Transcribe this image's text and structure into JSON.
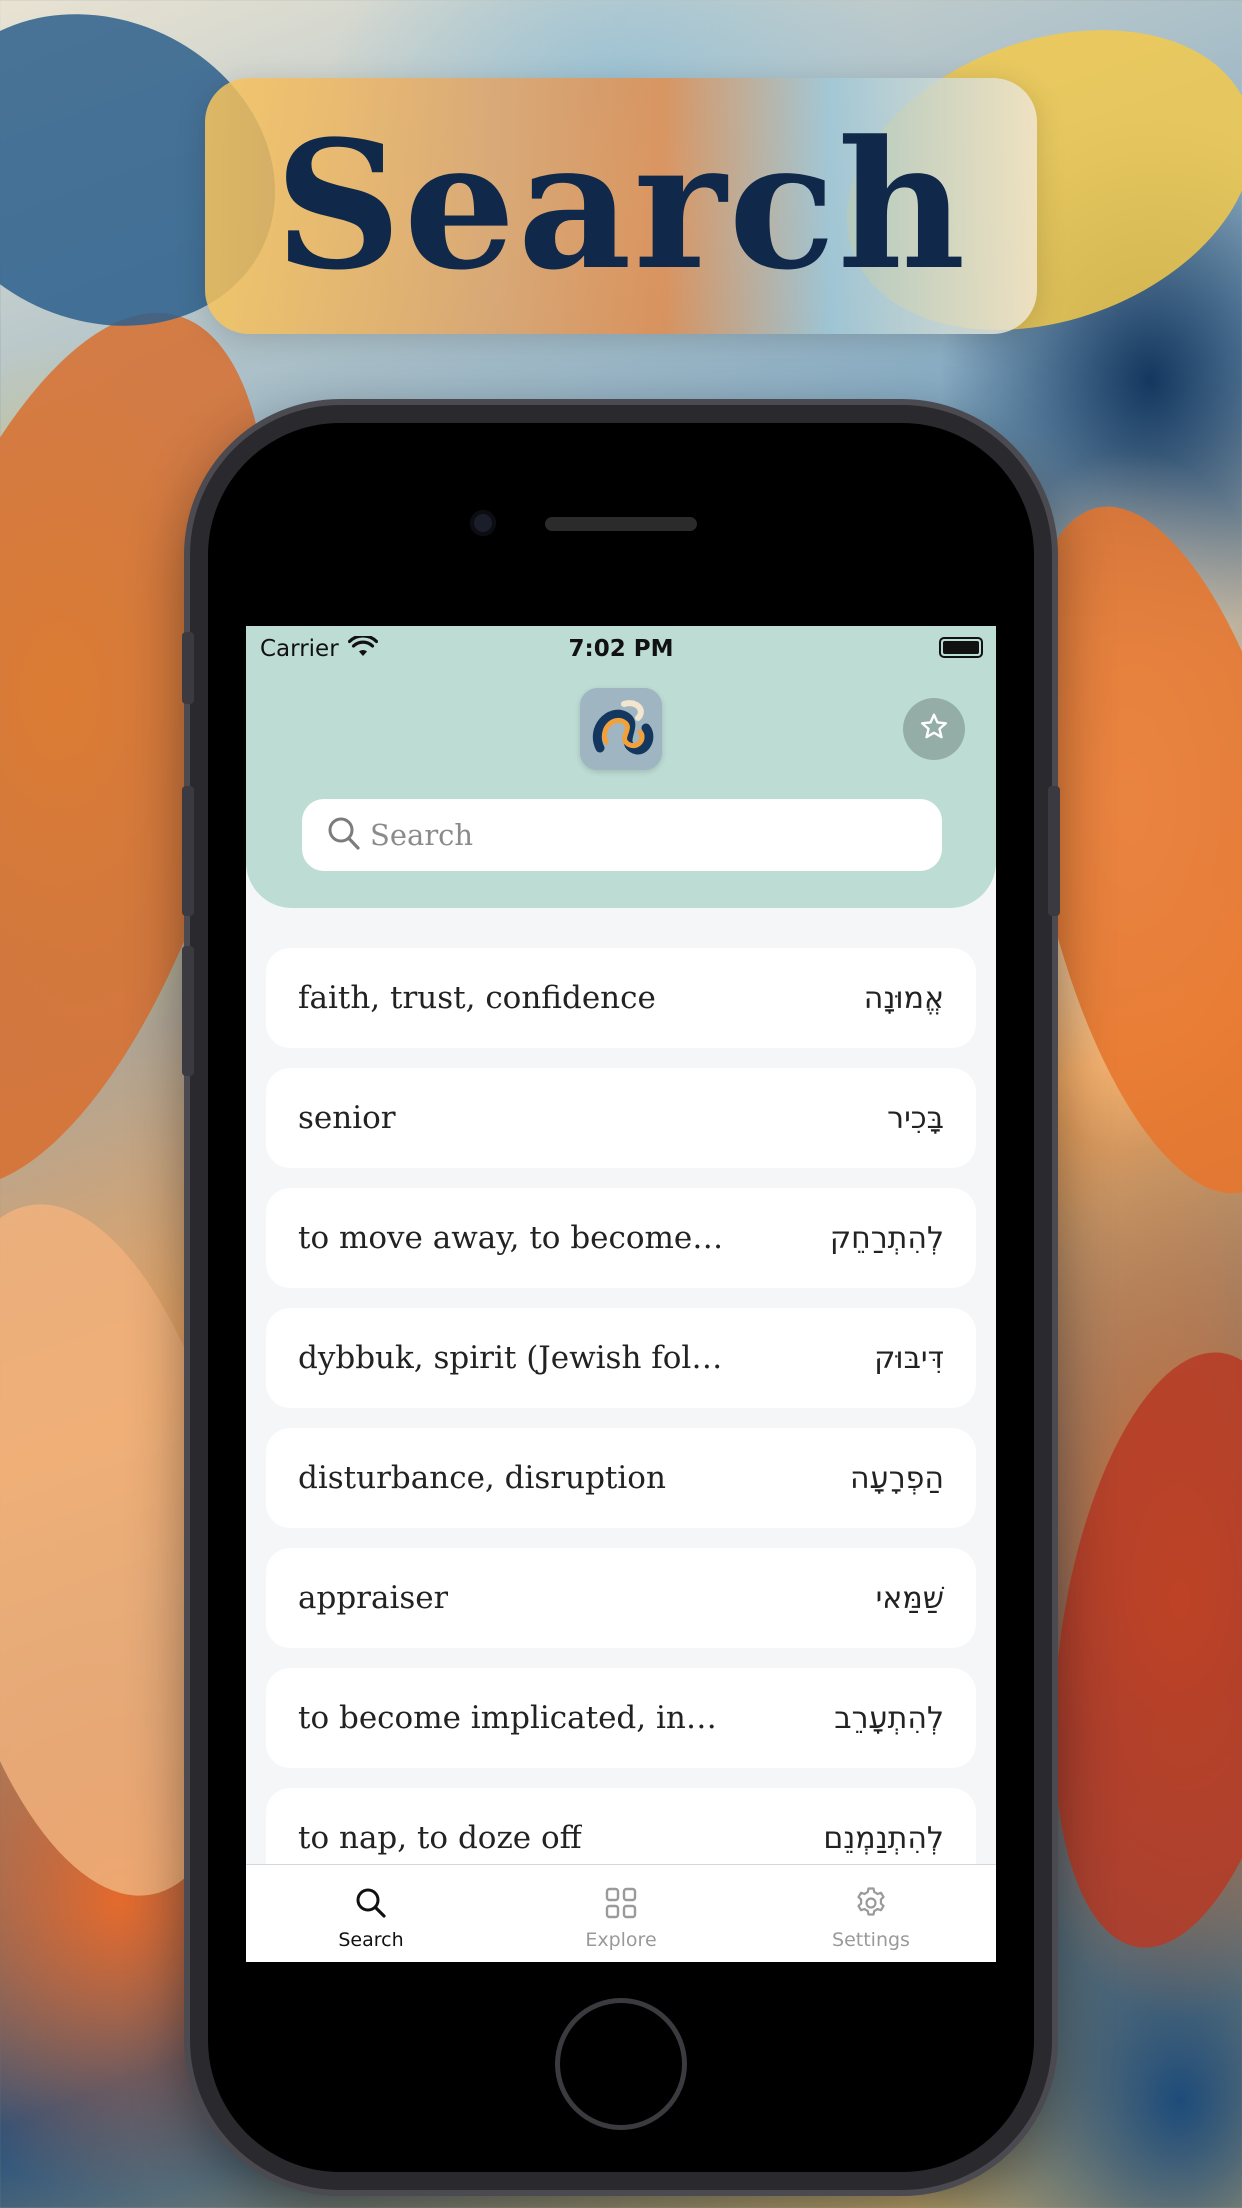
{
  "banner": {
    "title": "Search"
  },
  "status_bar": {
    "carrier": "Carrier",
    "time": "7:02 PM"
  },
  "header": {
    "logo_icon": "app-logo-icon",
    "favorites_icon": "star-icon"
  },
  "search": {
    "placeholder": "Search",
    "value": ""
  },
  "words": [
    {
      "english": "faith, trust, confidence",
      "hebrew": "אֱמוּנָה"
    },
    {
      "english": "senior",
      "hebrew": "בָּכִיר"
    },
    {
      "english": "to move away, to become f...",
      "hebrew": "לְהִתְרַחֵק"
    },
    {
      "english": "dybbuk, spirit (Jewish folk...",
      "hebrew": "דִּיבּוּק"
    },
    {
      "english": "disturbance, disruption",
      "hebrew": "הַפְרָעָה"
    },
    {
      "english": "appraiser",
      "hebrew": "שַׁמַּאי"
    },
    {
      "english": "to become implicated, invo...",
      "hebrew": "לְהִתְעָרֵב"
    },
    {
      "english": "to nap, to doze off",
      "hebrew": "לְהִתְנַמְנֵם"
    }
  ],
  "tabs": [
    {
      "label": "Search",
      "icon": "search-icon",
      "active": true
    },
    {
      "label": "Explore",
      "icon": "grid-icon",
      "active": false
    },
    {
      "label": "Settings",
      "icon": "gear-icon",
      "active": false
    }
  ],
  "colors": {
    "header_bg": "#bcdcd4",
    "title_text": "#10294a",
    "inactive_tab": "#9a9a9a"
  }
}
